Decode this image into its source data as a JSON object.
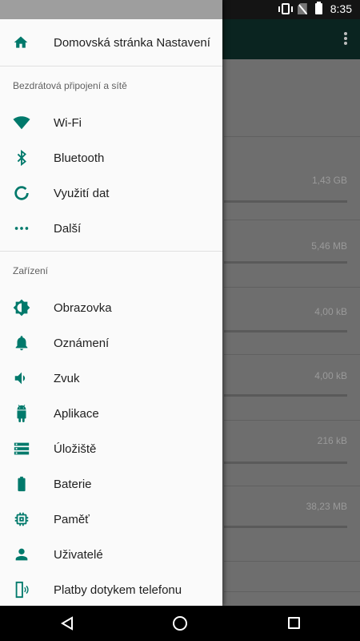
{
  "status_bar": {
    "time": "8:35"
  },
  "background": {
    "sizes": [
      "1,43 GB",
      "5,46 MB",
      "4,00 kB",
      "4,00 kB",
      "216 kB",
      "38,23 MB"
    ]
  },
  "drawer": {
    "home_label": "Domovská stránka Nastavení",
    "sections": [
      {
        "title": "Bezdrátová připojení a sítě",
        "items": [
          "Wi-Fi",
          "Bluetooth",
          "Využití dat",
          "Další"
        ]
      },
      {
        "title": "Zařízení",
        "items": [
          "Obrazovka",
          "Oznámení",
          "Zvuk",
          "Aplikace",
          "Úložiště",
          "Baterie",
          "Paměť",
          "Uživatelé",
          "Platby dotykem telefonu"
        ]
      }
    ]
  },
  "colors": {
    "accent": "#00796b"
  }
}
